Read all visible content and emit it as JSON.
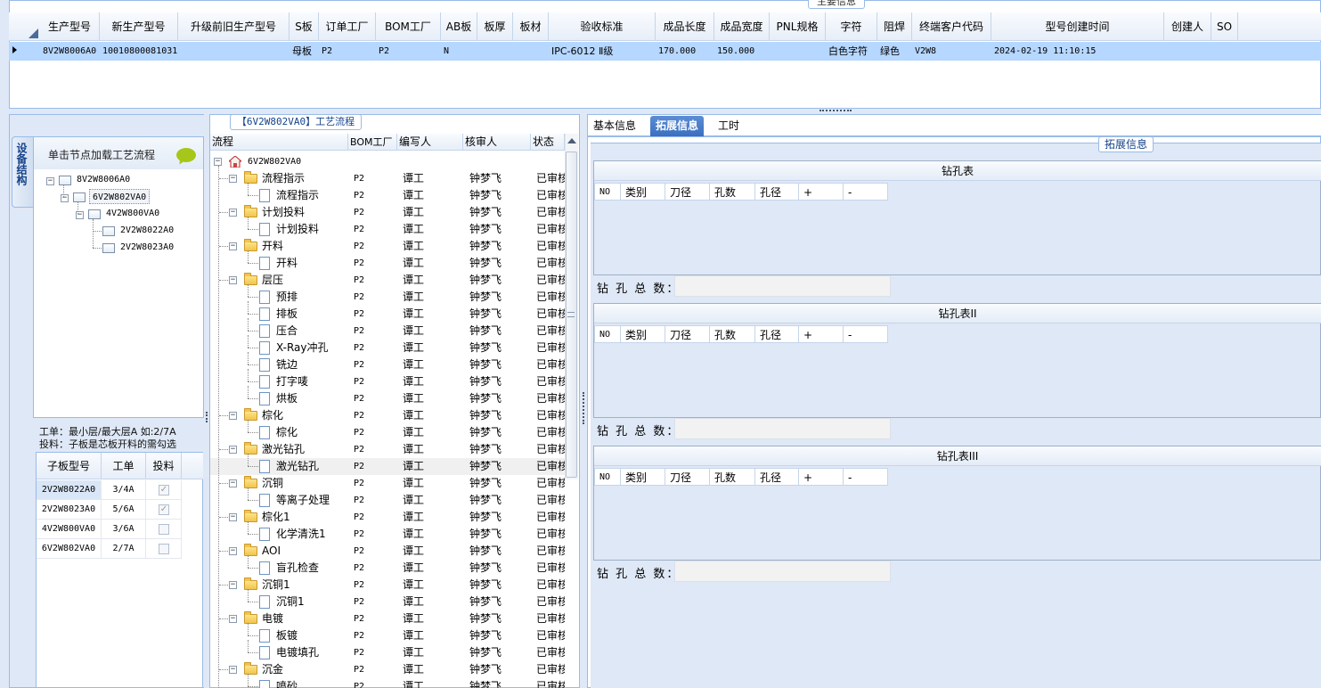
{
  "main_info": {
    "group_title": "主要信息",
    "columns": [
      "生产型号",
      "新生产型号",
      "升级前旧生产型号",
      "S板",
      "订单工厂",
      "BOM工厂",
      "AB板",
      "板厚",
      "板材",
      "验收标准",
      "成品长度",
      "成品宽度",
      "PNL规格",
      "字符",
      "阻焊",
      "终端客户代码",
      "型号创建时间",
      "创建人",
      "SO"
    ],
    "row": [
      "8V2W8006A0",
      "10010800081031",
      "",
      "母板",
      "P2",
      "P2",
      "N",
      "",
      "",
      "IPC-6012 Ⅱ级",
      "170.000",
      "150.000",
      "",
      "白色字符",
      "绿色",
      "V2W8",
      "2024-02-19 11:10:15",
      "",
      ""
    ]
  },
  "device_panel": {
    "vertical_tab": "设备结构",
    "header": "单击节点加载工艺流程",
    "tree": [
      "8V2W8006A0",
      "6V2W802VA0",
      "4V2W800VA0",
      "2V2W8022A0",
      "2V2W8023A0"
    ],
    "hint_line1": "工单：最小层/最大层A 如:2/7A",
    "hint_line2": "投料：子板是芯板开料的需勾选",
    "sub_columns": [
      "子板型号",
      "工单",
      "投料"
    ],
    "sub_rows": [
      {
        "model": "2V2W8022A0",
        "order": "3/4A",
        "feed": true
      },
      {
        "model": "2V2W8023A0",
        "order": "5/6A",
        "feed": true
      },
      {
        "model": "4V2W800VA0",
        "order": "3/6A",
        "feed": false
      },
      {
        "model": "6V2W802VA0",
        "order": "2/7A",
        "feed": false
      }
    ]
  },
  "process": {
    "title": "【6V2W802VA0】工艺流程",
    "columns": [
      "流程",
      "BOM工厂",
      "编写人",
      "核审人",
      "状态"
    ],
    "root": "6V2W802VA0",
    "rows": [
      {
        "name": "流程指示",
        "level": 1,
        "bom": "P2",
        "writer": "谭工",
        "reviewer": "钟梦飞",
        "status": "已审核"
      },
      {
        "name": "流程指示",
        "level": 2,
        "bom": "P2",
        "writer": "谭工",
        "reviewer": "钟梦飞",
        "status": "已审核"
      },
      {
        "name": "计划投料",
        "level": 1,
        "bom": "P2",
        "writer": "谭工",
        "reviewer": "钟梦飞",
        "status": "已审核"
      },
      {
        "name": "计划投料",
        "level": 2,
        "bom": "P2",
        "writer": "谭工",
        "reviewer": "钟梦飞",
        "status": "已审核"
      },
      {
        "name": "开料",
        "level": 1,
        "bom": "P2",
        "writer": "谭工",
        "reviewer": "钟梦飞",
        "status": "已审核"
      },
      {
        "name": "开料",
        "level": 2,
        "bom": "P2",
        "writer": "谭工",
        "reviewer": "钟梦飞",
        "status": "已审核"
      },
      {
        "name": "层压",
        "level": 1,
        "bom": "P2",
        "writer": "谭工",
        "reviewer": "钟梦飞",
        "status": "已审核"
      },
      {
        "name": "预排",
        "level": 2,
        "bom": "P2",
        "writer": "谭工",
        "reviewer": "钟梦飞",
        "status": "已审核"
      },
      {
        "name": "排板",
        "level": 2,
        "bom": "P2",
        "writer": "谭工",
        "reviewer": "钟梦飞",
        "status": "已审核"
      },
      {
        "name": "压合",
        "level": 2,
        "bom": "P2",
        "writer": "谭工",
        "reviewer": "钟梦飞",
        "status": "已审核"
      },
      {
        "name": "X-Ray冲孔",
        "level": 2,
        "bom": "P2",
        "writer": "谭工",
        "reviewer": "钟梦飞",
        "status": "已审核"
      },
      {
        "name": "铣边",
        "level": 2,
        "bom": "P2",
        "writer": "谭工",
        "reviewer": "钟梦飞",
        "status": "已审核"
      },
      {
        "name": "打字唛",
        "level": 2,
        "bom": "P2",
        "writer": "谭工",
        "reviewer": "钟梦飞",
        "status": "已审核"
      },
      {
        "name": "烘板",
        "level": 2,
        "bom": "P2",
        "writer": "谭工",
        "reviewer": "钟梦飞",
        "status": "已审核"
      },
      {
        "name": "棕化",
        "level": 1,
        "bom": "P2",
        "writer": "谭工",
        "reviewer": "钟梦飞",
        "status": "已审核"
      },
      {
        "name": "棕化",
        "level": 2,
        "bom": "P2",
        "writer": "谭工",
        "reviewer": "钟梦飞",
        "status": "已审核"
      },
      {
        "name": "激光钻孔",
        "level": 1,
        "bom": "P2",
        "writer": "谭工",
        "reviewer": "钟梦飞",
        "status": "已审核"
      },
      {
        "name": "激光钻孔",
        "level": 2,
        "bom": "P2",
        "writer": "谭工",
        "reviewer": "钟梦飞",
        "status": "已审核",
        "selected": true
      },
      {
        "name": "沉铜",
        "level": 1,
        "bom": "P2",
        "writer": "谭工",
        "reviewer": "钟梦飞",
        "status": "已审核"
      },
      {
        "name": "等离子处理",
        "level": 2,
        "bom": "P2",
        "writer": "谭工",
        "reviewer": "钟梦飞",
        "status": "已审核"
      },
      {
        "name": "棕化1",
        "level": 1,
        "bom": "P2",
        "writer": "谭工",
        "reviewer": "钟梦飞",
        "status": "已审核"
      },
      {
        "name": "化学清洗1",
        "level": 2,
        "bom": "P2",
        "writer": "谭工",
        "reviewer": "钟梦飞",
        "status": "已审核"
      },
      {
        "name": "AOI",
        "level": 1,
        "bom": "P2",
        "writer": "谭工",
        "reviewer": "钟梦飞",
        "status": "已审核"
      },
      {
        "name": "盲孔检查",
        "level": 2,
        "bom": "P2",
        "writer": "谭工",
        "reviewer": "钟梦飞",
        "status": "已审核"
      },
      {
        "name": "沉铜1",
        "level": 1,
        "bom": "P2",
        "writer": "谭工",
        "reviewer": "钟梦飞",
        "status": "已审核"
      },
      {
        "name": "沉铜1",
        "level": 2,
        "bom": "P2",
        "writer": "谭工",
        "reviewer": "钟梦飞",
        "status": "已审核"
      },
      {
        "name": "电镀",
        "level": 1,
        "bom": "P2",
        "writer": "谭工",
        "reviewer": "钟梦飞",
        "status": "已审核"
      },
      {
        "name": "板镀",
        "level": 2,
        "bom": "P2",
        "writer": "谭工",
        "reviewer": "钟梦飞",
        "status": "已审核"
      },
      {
        "name": "电镀填孔",
        "level": 2,
        "bom": "P2",
        "writer": "谭工",
        "reviewer": "钟梦飞",
        "status": "已审核"
      },
      {
        "name": "沉金",
        "level": 1,
        "bom": "P2",
        "writer": "谭工",
        "reviewer": "钟梦飞",
        "status": "已审核"
      },
      {
        "name": "喷砂",
        "level": 2,
        "bom": "P2",
        "writer": "谭工",
        "reviewer": "钟梦飞",
        "status": "已审核"
      }
    ]
  },
  "right_panel": {
    "tabs": [
      "基本信息",
      "拓展信息",
      "工时"
    ],
    "active_tab": "拓展信息",
    "section_title": "拓展信息",
    "drill_tables": [
      {
        "title": "钻孔表",
        "columns": [
          "NO",
          "类别",
          "刀径",
          "孔数",
          "孔径",
          "+",
          "-"
        ],
        "count_label": "钻 孔 总 数：",
        "count_value": ""
      },
      {
        "title": "钻孔表II",
        "columns": [
          "NO",
          "类别",
          "刀径",
          "孔数",
          "孔径",
          "+",
          "-"
        ],
        "count_label": "钻 孔 总 数：",
        "count_value": ""
      },
      {
        "title": "钻孔表III",
        "columns": [
          "NO",
          "类别",
          "刀径",
          "孔数",
          "孔径",
          "+",
          "-"
        ],
        "count_label": "钻 孔 总 数：",
        "count_value": ""
      }
    ]
  },
  "colors": {
    "accent": "#3a6fc0",
    "selected_row": "#b6d7ff",
    "panel_bg": "#dfe8f6",
    "border": "#99bbe8",
    "folder": "#f2c44a"
  }
}
